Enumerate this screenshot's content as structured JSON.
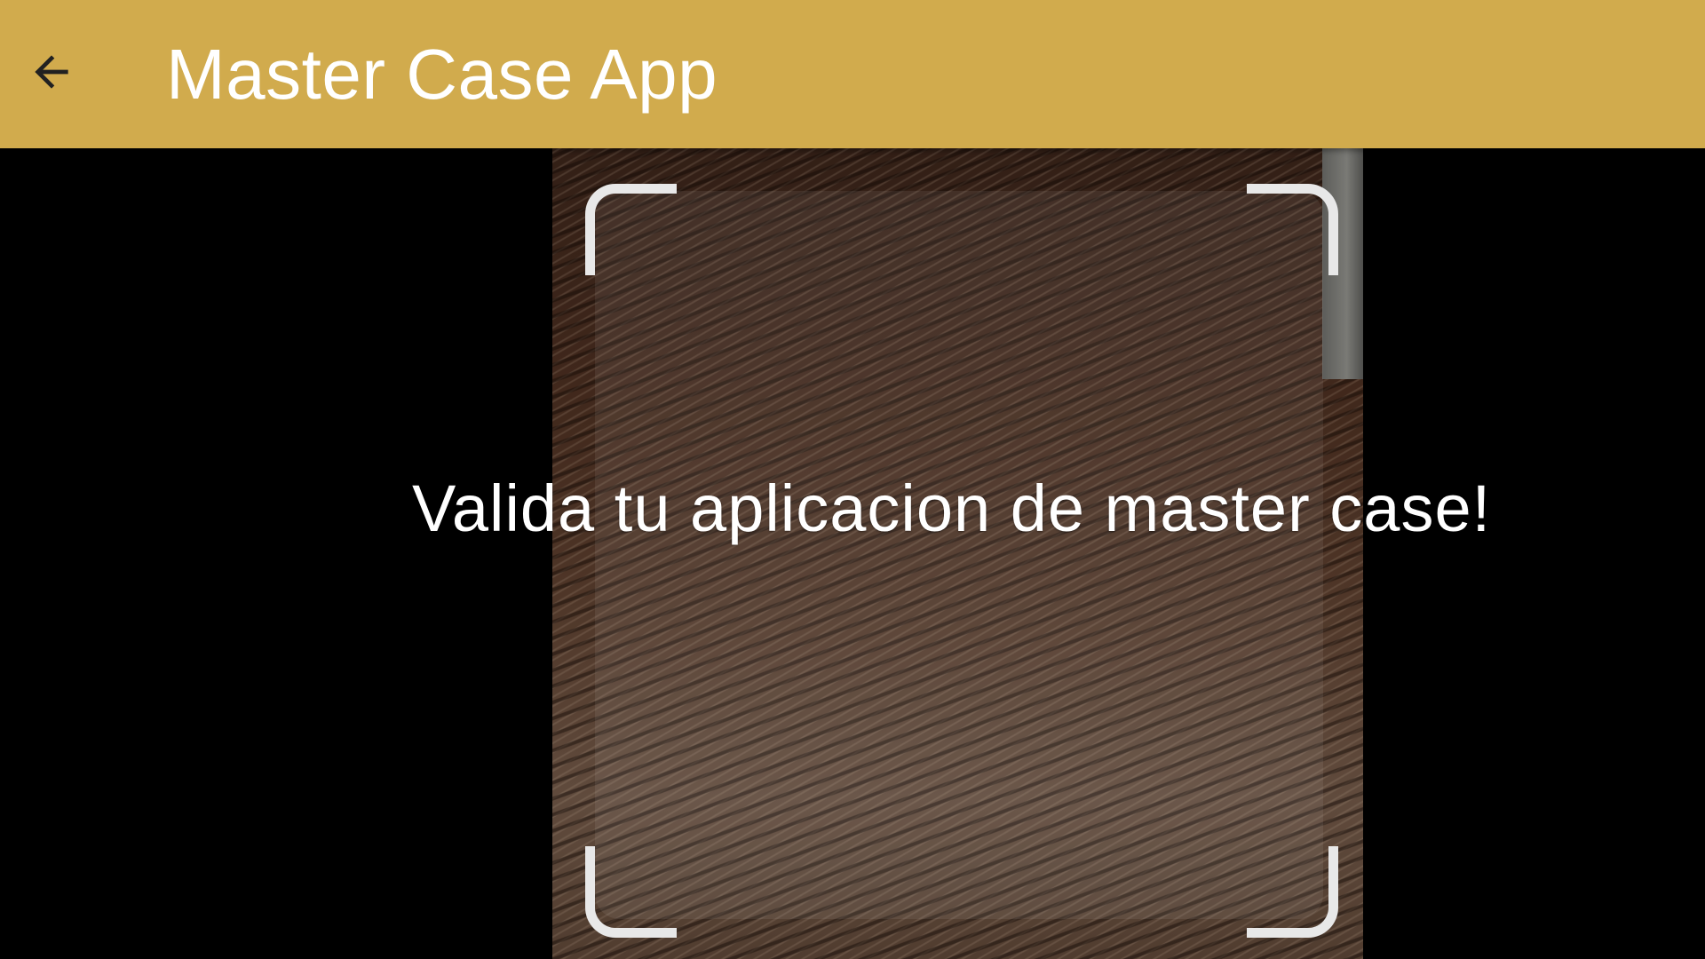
{
  "app_bar": {
    "title": "Master Case App",
    "back_icon": "arrow-back-icon",
    "background_color": "#D1AB4D",
    "title_color": "#FFFFFF"
  },
  "scanner": {
    "message": "Valida tu aplicacion de master case!",
    "frame_color": "#E8E8E8",
    "background_color": "#000000"
  }
}
